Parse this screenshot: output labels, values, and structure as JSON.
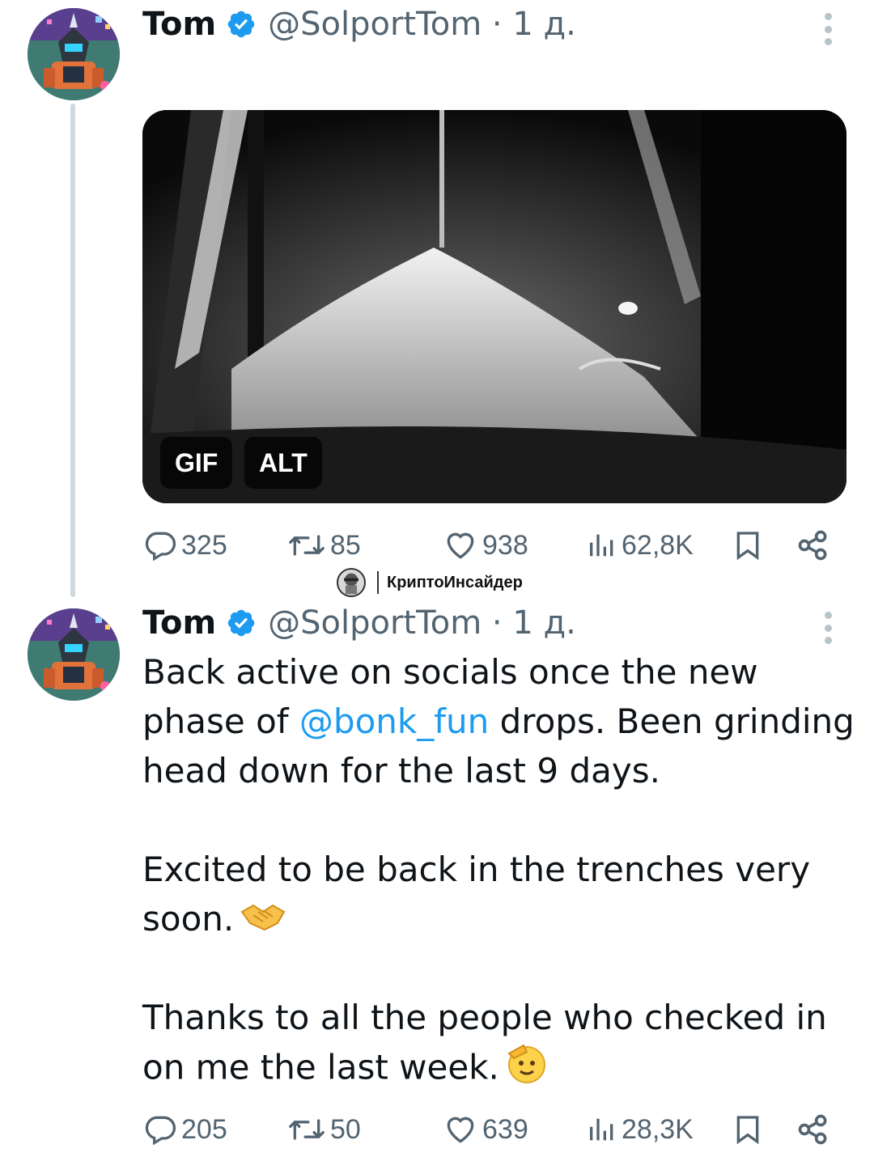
{
  "colors": {
    "accent": "#1d9bf0",
    "text": "#0f1419",
    "muted": "#536471",
    "thread_line": "#cfd9de"
  },
  "tweet1": {
    "author_name": "Tom",
    "verified_icon": "verified-badge-icon",
    "handle_time": "@SolportTom · 1 д.",
    "media": {
      "gif_label": "GIF",
      "alt_label": "ALT"
    },
    "actions": {
      "replies": "325",
      "reposts": "85",
      "likes": "938",
      "views": "62,8K"
    }
  },
  "watermark": {
    "text": "КриптоИнсайдер"
  },
  "tweet2": {
    "author_name": "Tom",
    "verified_icon": "verified-badge-icon",
    "handle_time": "@SolportTom · 1 д.",
    "text": {
      "line1": "Back active on socials once the new",
      "line2_pre": "phase of ",
      "line2_mention": "@bonk_fun",
      "line2_post": " drops. Been grinding",
      "line3": "head down for the last 9 days.",
      "line4": "Excited to be back in the trenches very",
      "line5": "soon.",
      "line5_emoji": "handshake-emoji",
      "line6": "Thanks to all the people who checked in",
      "line7": "on me the last week.",
      "line7_emoji": "saluting-face-emoji"
    },
    "actions": {
      "replies": "205",
      "reposts": "50",
      "likes": "639",
      "views": "28,3K"
    }
  }
}
